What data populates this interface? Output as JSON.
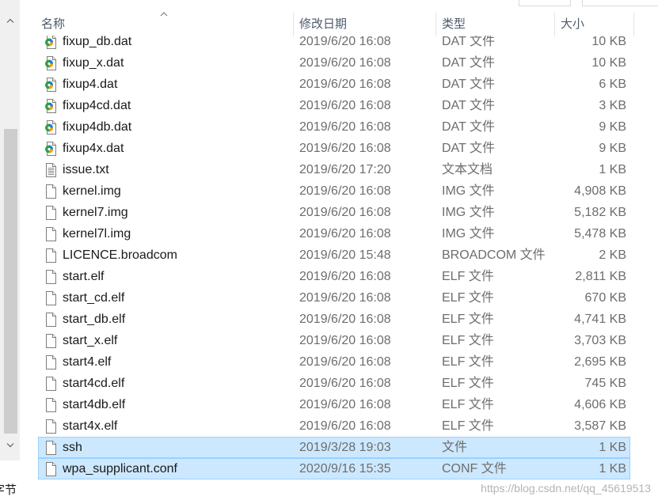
{
  "header": {
    "columns": {
      "name": "名称",
      "modified": "修改日期",
      "type": "类型",
      "size": "大小"
    },
    "sort_column": "name",
    "sort_indicator_icon": "sort-ascending-icon"
  },
  "files": [
    {
      "name": "fixup_db.dat",
      "modified": "2019/6/20 16:08",
      "type": "DAT 文件",
      "size": "10 KB",
      "icon": "media-file-icon",
      "selected": false
    },
    {
      "name": "fixup_x.dat",
      "modified": "2019/6/20 16:08",
      "type": "DAT 文件",
      "size": "10 KB",
      "icon": "media-file-icon",
      "selected": false
    },
    {
      "name": "fixup4.dat",
      "modified": "2019/6/20 16:08",
      "type": "DAT 文件",
      "size": "6 KB",
      "icon": "media-file-icon",
      "selected": false
    },
    {
      "name": "fixup4cd.dat",
      "modified": "2019/6/20 16:08",
      "type": "DAT 文件",
      "size": "3 KB",
      "icon": "media-file-icon",
      "selected": false
    },
    {
      "name": "fixup4db.dat",
      "modified": "2019/6/20 16:08",
      "type": "DAT 文件",
      "size": "9 KB",
      "icon": "media-file-icon",
      "selected": false
    },
    {
      "name": "fixup4x.dat",
      "modified": "2019/6/20 16:08",
      "type": "DAT 文件",
      "size": "9 KB",
      "icon": "media-file-icon",
      "selected": false
    },
    {
      "name": "issue.txt",
      "modified": "2019/6/20 17:20",
      "type": "文本文档",
      "size": "1 KB",
      "icon": "text-file-icon",
      "selected": false
    },
    {
      "name": "kernel.img",
      "modified": "2019/6/20 16:08",
      "type": "IMG 文件",
      "size": "4,908 KB",
      "icon": "file-icon",
      "selected": false
    },
    {
      "name": "kernel7.img",
      "modified": "2019/6/20 16:08",
      "type": "IMG 文件",
      "size": "5,182 KB",
      "icon": "file-icon",
      "selected": false
    },
    {
      "name": "kernel7l.img",
      "modified": "2019/6/20 16:08",
      "type": "IMG 文件",
      "size": "5,478 KB",
      "icon": "file-icon",
      "selected": false
    },
    {
      "name": "LICENCE.broadcom",
      "modified": "2019/6/20 15:48",
      "type": "BROADCOM 文件",
      "size": "2 KB",
      "icon": "file-icon",
      "selected": false
    },
    {
      "name": "start.elf",
      "modified": "2019/6/20 16:08",
      "type": "ELF 文件",
      "size": "2,811 KB",
      "icon": "file-icon",
      "selected": false
    },
    {
      "name": "start_cd.elf",
      "modified": "2019/6/20 16:08",
      "type": "ELF 文件",
      "size": "670 KB",
      "icon": "file-icon",
      "selected": false
    },
    {
      "name": "start_db.elf",
      "modified": "2019/6/20 16:08",
      "type": "ELF 文件",
      "size": "4,741 KB",
      "icon": "file-icon",
      "selected": false
    },
    {
      "name": "start_x.elf",
      "modified": "2019/6/20 16:08",
      "type": "ELF 文件",
      "size": "3,703 KB",
      "icon": "file-icon",
      "selected": false
    },
    {
      "name": "start4.elf",
      "modified": "2019/6/20 16:08",
      "type": "ELF 文件",
      "size": "2,695 KB",
      "icon": "file-icon",
      "selected": false
    },
    {
      "name": "start4cd.elf",
      "modified": "2019/6/20 16:08",
      "type": "ELF 文件",
      "size": "745 KB",
      "icon": "file-icon",
      "selected": false
    },
    {
      "name": "start4db.elf",
      "modified": "2019/6/20 16:08",
      "type": "ELF 文件",
      "size": "4,606 KB",
      "icon": "file-icon",
      "selected": false
    },
    {
      "name": "start4x.elf",
      "modified": "2019/6/20 16:08",
      "type": "ELF 文件",
      "size": "3,587 KB",
      "icon": "file-icon",
      "selected": false
    },
    {
      "name": "ssh",
      "modified": "2019/3/28 19:03",
      "type": "文件",
      "size": "1 KB",
      "icon": "file-icon",
      "selected": true
    },
    {
      "name": "wpa_supplicant.conf",
      "modified": "2020/9/16 15:35",
      "type": "CONF 文件",
      "size": "1 KB",
      "icon": "file-icon",
      "selected": true
    }
  ],
  "status_bar": {
    "text": "字节"
  },
  "watermark": "https://blog.csdn.net/qq_45619513",
  "scrollbar": {
    "up_icon": "chevron-up-icon",
    "down_icon": "chevron-down-icon"
  },
  "colors": {
    "selection_background": "#cce8ff",
    "selection_border": "#99d1ff",
    "secondary_text": "#6d6d6d"
  }
}
